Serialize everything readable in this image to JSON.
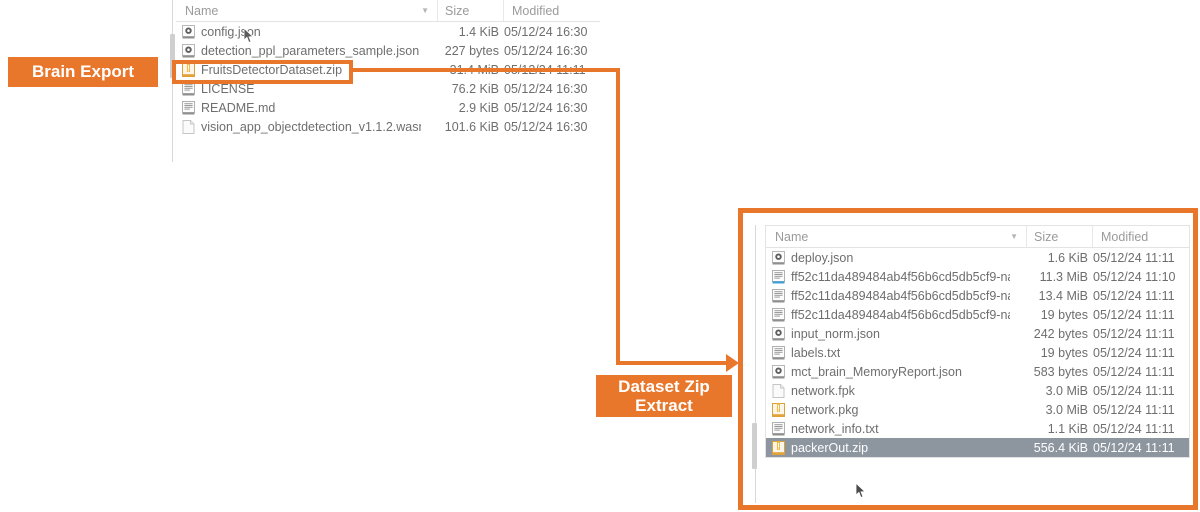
{
  "annotations": {
    "brain_export_label": "Brain Export",
    "dataset_zip_label": "Dataset Zip\nExtract",
    "dataset_zip_line1": "Dataset Zip",
    "dataset_zip_line2": "Extract",
    "accent_color": "#e8772c",
    "highlighted_file": "FruitsDetectorDataset.zip"
  },
  "panel_brain": {
    "name": "brain-export-file-list",
    "columns": {
      "name": "Name",
      "size": "Size",
      "modified": "Modified"
    },
    "sort_indicator": "▼",
    "rows": [
      {
        "icon": "json-gear-icon",
        "name": "config.json",
        "size": "1.4 KiB",
        "modified": "05/12/24 16:30",
        "selected": false,
        "highlighted": false
      },
      {
        "icon": "json-gear-icon",
        "name": "detection_ppl_parameters_sample.json",
        "size": "227 bytes",
        "modified": "05/12/24 16:30",
        "selected": false,
        "highlighted": false
      },
      {
        "icon": "zip-archive-icon",
        "name": "FruitsDetectorDataset.zip",
        "size": "31.4 MiB",
        "modified": "05/12/24 11:11",
        "selected": false,
        "highlighted": true
      },
      {
        "icon": "text-document-icon",
        "name": "LICENSE",
        "size": "76.2 KiB",
        "modified": "05/12/24 16:30",
        "selected": false,
        "highlighted": false
      },
      {
        "icon": "text-document-icon",
        "name": "README.md",
        "size": "2.9 KiB",
        "modified": "05/12/24 16:30",
        "selected": false,
        "highlighted": false
      },
      {
        "icon": "blank-document-icon",
        "name": "vision_app_objectdetection_v1.1.2.wasm",
        "size": "101.6 KiB",
        "modified": "05/12/24 16:30",
        "selected": false,
        "highlighted": false
      }
    ]
  },
  "panel_zip": {
    "name": "dataset-zip-extract-file-list",
    "columns": {
      "name": "Name",
      "size": "Size",
      "modified": "Modified"
    },
    "sort_indicator": "▼",
    "rows": [
      {
        "icon": "json-gear-icon",
        "name": "deploy.json",
        "size": "1.6 KiB",
        "modified": "05/12/24 11:11",
        "selected": false
      },
      {
        "icon": "blue-text-document-icon",
        "name": "ff52c11da489484ab4f56b6cd5db5cf9-na...",
        "size": "11.3 MiB",
        "modified": "05/12/24 11:10",
        "selected": false
      },
      {
        "icon": "text-document-icon",
        "name": "ff52c11da489484ab4f56b6cd5db5cf9-na...",
        "size": "13.4 MiB",
        "modified": "05/12/24 11:11",
        "selected": false
      },
      {
        "icon": "text-document-icon",
        "name": "ff52c11da489484ab4f56b6cd5db5cf9-na...",
        "size": "19 bytes",
        "modified": "05/12/24 11:11",
        "selected": false
      },
      {
        "icon": "json-gear-icon",
        "name": "input_norm.json",
        "size": "242 bytes",
        "modified": "05/12/24 11:11",
        "selected": false
      },
      {
        "icon": "text-document-icon",
        "name": "labels.txt",
        "size": "19 bytes",
        "modified": "05/12/24 11:11",
        "selected": false
      },
      {
        "icon": "json-gear-icon",
        "name": "mct_brain_MemoryReport.json",
        "size": "583 bytes",
        "modified": "05/12/24 11:11",
        "selected": false
      },
      {
        "icon": "blank-document-icon",
        "name": "network.fpk",
        "size": "3.0 MiB",
        "modified": "05/12/24 11:11",
        "selected": false
      },
      {
        "icon": "zip-archive-icon",
        "name": "network.pkg",
        "size": "3.0 MiB",
        "modified": "05/12/24 11:11",
        "selected": false
      },
      {
        "icon": "text-document-icon",
        "name": "network_info.txt",
        "size": "1.1 KiB",
        "modified": "05/12/24 11:11",
        "selected": false
      },
      {
        "icon": "zip-archive-icon",
        "name": "packerOut.zip",
        "size": "556.4 KiB",
        "modified": "05/12/24 11:11",
        "selected": true
      }
    ]
  }
}
